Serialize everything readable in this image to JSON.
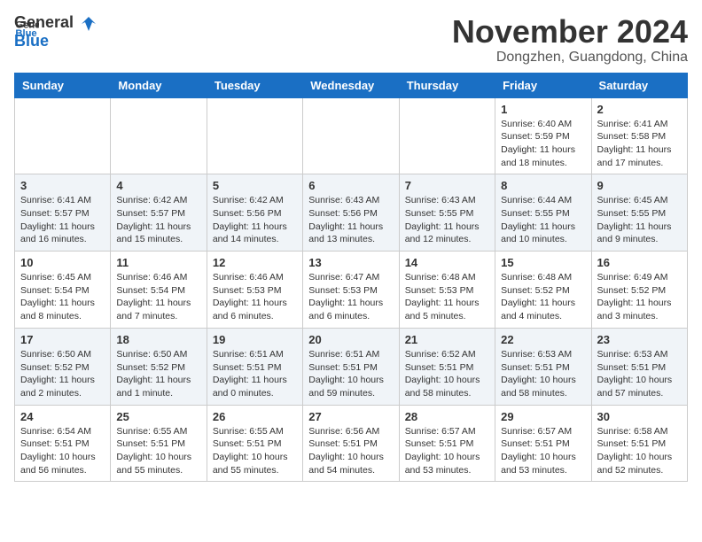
{
  "header": {
    "logo_general": "General",
    "logo_blue": "Blue",
    "month_title": "November 2024",
    "location": "Dongzhen, Guangdong, China"
  },
  "weekdays": [
    "Sunday",
    "Monday",
    "Tuesday",
    "Wednesday",
    "Thursday",
    "Friday",
    "Saturday"
  ],
  "weeks": [
    [
      {
        "day": "",
        "info": ""
      },
      {
        "day": "",
        "info": ""
      },
      {
        "day": "",
        "info": ""
      },
      {
        "day": "",
        "info": ""
      },
      {
        "day": "",
        "info": ""
      },
      {
        "day": "1",
        "info": "Sunrise: 6:40 AM\nSunset: 5:59 PM\nDaylight: 11 hours and 18 minutes."
      },
      {
        "day": "2",
        "info": "Sunrise: 6:41 AM\nSunset: 5:58 PM\nDaylight: 11 hours and 17 minutes."
      }
    ],
    [
      {
        "day": "3",
        "info": "Sunrise: 6:41 AM\nSunset: 5:57 PM\nDaylight: 11 hours and 16 minutes."
      },
      {
        "day": "4",
        "info": "Sunrise: 6:42 AM\nSunset: 5:57 PM\nDaylight: 11 hours and 15 minutes."
      },
      {
        "day": "5",
        "info": "Sunrise: 6:42 AM\nSunset: 5:56 PM\nDaylight: 11 hours and 14 minutes."
      },
      {
        "day": "6",
        "info": "Sunrise: 6:43 AM\nSunset: 5:56 PM\nDaylight: 11 hours and 13 minutes."
      },
      {
        "day": "7",
        "info": "Sunrise: 6:43 AM\nSunset: 5:55 PM\nDaylight: 11 hours and 12 minutes."
      },
      {
        "day": "8",
        "info": "Sunrise: 6:44 AM\nSunset: 5:55 PM\nDaylight: 11 hours and 10 minutes."
      },
      {
        "day": "9",
        "info": "Sunrise: 6:45 AM\nSunset: 5:55 PM\nDaylight: 11 hours and 9 minutes."
      }
    ],
    [
      {
        "day": "10",
        "info": "Sunrise: 6:45 AM\nSunset: 5:54 PM\nDaylight: 11 hours and 8 minutes."
      },
      {
        "day": "11",
        "info": "Sunrise: 6:46 AM\nSunset: 5:54 PM\nDaylight: 11 hours and 7 minutes."
      },
      {
        "day": "12",
        "info": "Sunrise: 6:46 AM\nSunset: 5:53 PM\nDaylight: 11 hours and 6 minutes."
      },
      {
        "day": "13",
        "info": "Sunrise: 6:47 AM\nSunset: 5:53 PM\nDaylight: 11 hours and 6 minutes."
      },
      {
        "day": "14",
        "info": "Sunrise: 6:48 AM\nSunset: 5:53 PM\nDaylight: 11 hours and 5 minutes."
      },
      {
        "day": "15",
        "info": "Sunrise: 6:48 AM\nSunset: 5:52 PM\nDaylight: 11 hours and 4 minutes."
      },
      {
        "day": "16",
        "info": "Sunrise: 6:49 AM\nSunset: 5:52 PM\nDaylight: 11 hours and 3 minutes."
      }
    ],
    [
      {
        "day": "17",
        "info": "Sunrise: 6:50 AM\nSunset: 5:52 PM\nDaylight: 11 hours and 2 minutes."
      },
      {
        "day": "18",
        "info": "Sunrise: 6:50 AM\nSunset: 5:52 PM\nDaylight: 11 hours and 1 minute."
      },
      {
        "day": "19",
        "info": "Sunrise: 6:51 AM\nSunset: 5:51 PM\nDaylight: 11 hours and 0 minutes."
      },
      {
        "day": "20",
        "info": "Sunrise: 6:51 AM\nSunset: 5:51 PM\nDaylight: 10 hours and 59 minutes."
      },
      {
        "day": "21",
        "info": "Sunrise: 6:52 AM\nSunset: 5:51 PM\nDaylight: 10 hours and 58 minutes."
      },
      {
        "day": "22",
        "info": "Sunrise: 6:53 AM\nSunset: 5:51 PM\nDaylight: 10 hours and 58 minutes."
      },
      {
        "day": "23",
        "info": "Sunrise: 6:53 AM\nSunset: 5:51 PM\nDaylight: 10 hours and 57 minutes."
      }
    ],
    [
      {
        "day": "24",
        "info": "Sunrise: 6:54 AM\nSunset: 5:51 PM\nDaylight: 10 hours and 56 minutes."
      },
      {
        "day": "25",
        "info": "Sunrise: 6:55 AM\nSunset: 5:51 PM\nDaylight: 10 hours and 55 minutes."
      },
      {
        "day": "26",
        "info": "Sunrise: 6:55 AM\nSunset: 5:51 PM\nDaylight: 10 hours and 55 minutes."
      },
      {
        "day": "27",
        "info": "Sunrise: 6:56 AM\nSunset: 5:51 PM\nDaylight: 10 hours and 54 minutes."
      },
      {
        "day": "28",
        "info": "Sunrise: 6:57 AM\nSunset: 5:51 PM\nDaylight: 10 hours and 53 minutes."
      },
      {
        "day": "29",
        "info": "Sunrise: 6:57 AM\nSunset: 5:51 PM\nDaylight: 10 hours and 53 minutes."
      },
      {
        "day": "30",
        "info": "Sunrise: 6:58 AM\nSunset: 5:51 PM\nDaylight: 10 hours and 52 minutes."
      }
    ]
  ]
}
